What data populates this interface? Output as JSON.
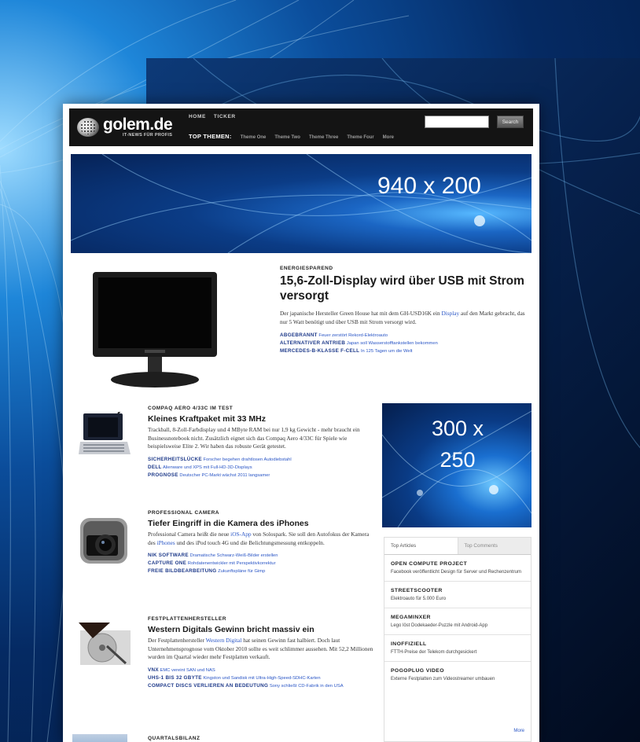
{
  "site": {
    "logo": "golem.de",
    "tagline": "IT-NEWS FÜR PROFIS",
    "nav_top": [
      "HOME",
      "TICKER"
    ],
    "themes_label": "TOP THEMEN:",
    "themes": [
      "Theme One",
      "Theme Two",
      "Theme Three",
      "Theme Four",
      "More"
    ],
    "search_placeholder": "",
    "search_button": "Search"
  },
  "banner": {
    "label": "940 x 200"
  },
  "ad": {
    "label": "300 x 250"
  },
  "feature": {
    "kicker": "ENERGIESPAREND",
    "title": "15,6-Zoll-Display wird über USB mit Strom versorgt",
    "desc_pre": "Der japanische Hersteller Green House hat mit dem GH-USD16K ein ",
    "desc_link": "Display",
    "desc_post": " auf den Markt gebracht, das nur 5 Watt benötigt und über USB mit Strom versorgt wird.",
    "related": [
      {
        "key": "ABGEBRANNT",
        "text": "Feuer zerstört Rekord-Elektroauto"
      },
      {
        "key": "ALTERNATIVER ANTRIEB",
        "text": "Japan soll Wasserstofftankstellen bekommen"
      },
      {
        "key": "MERCEDES-B-KLASSE F-CELL",
        "text": "In 125 Tagen um die Welt"
      }
    ]
  },
  "articles": [
    {
      "kicker": "COMPAQ AERO 4/33C IM TEST",
      "title": "Kleines Kraftpaket mit 33 MHz",
      "desc": "Trackball, 8-Zoll-Farbdisplay und 4 MByte RAM bei nur 1,9 kg Gewicht - mehr braucht ein Businessnotebook nicht. Zusätzlich eignet sich das Compaq Aero 4/33C für Spiele wie beispielsweise Elite 2. Wir haben das robuste Gerät getestet.",
      "related": [
        {
          "key": "SICHERHEITSLÜCKE",
          "text": "Forscher begehen drahtlosen Autodiebstahl"
        },
        {
          "key": "DELL",
          "text": "Alienware und XPS mit Full-HD-3D-Displays"
        },
        {
          "key": "PROGNOSE",
          "text": "Deutscher PC-Markt wächst 2011 langsamer"
        }
      ]
    },
    {
      "kicker": "PROFESSIONAL CAMERA",
      "title": "Tiefer Eingriff in die Kamera des iPhones",
      "desc_parts": [
        "Professional Camera heißt die neue ",
        "iOS-App",
        " von Solospark. Sie soll den Autofokus der Kamera des ",
        "iPhones",
        " und des iPod touch 4G und die Belichtungsmessung entkoppeln."
      ],
      "related": [
        {
          "key": "NIK SOFTWARE",
          "text": "Dramatische Schwarz-Weiß-Bilder erstellen"
        },
        {
          "key": "CAPTURE ONE",
          "text": "Rohdatenentwickler mit Perspektivkorrektur"
        },
        {
          "key": "FREIE BILDBEARBEITUNG",
          "text": "Zukunftspläne für Gimp"
        }
      ]
    },
    {
      "kicker": "FESTPLATTENHERSTELLER",
      "title": "Western Digitals Gewinn bricht massiv ein",
      "desc_parts": [
        "Der Festplattenhersteller ",
        "Western Digital",
        " hat seinen Gewinn fast halbiert. Doch laut Unternehmensprognose vom Oktober 2010 sollte es weit schlimmer aussehen. Mit 52,2 Millionen wurden im Quartal wieder mehr Festplatten verkauft."
      ],
      "related": [
        {
          "key": "VNX",
          "text": "EMC vereint SAN und NAS"
        },
        {
          "key": "UHS-1 BIS 32 GBYTE",
          "text": "Kingston und Sandisk mit Ultra-High-Speed-SDHC-Karten"
        },
        {
          "key": "COMPACT DISCS VERLIEREN AN BEDEUTUNG",
          "text": "Sony schließt CD-Fabrik in den USA"
        }
      ]
    }
  ],
  "last_kicker": "QUARTALSBILANZ",
  "sidebar": {
    "tabs": [
      "Top Articles",
      "Top Comments"
    ],
    "items": [
      {
        "title": "OPEN COMPUTE PROJECT",
        "desc": "Facebook veröffentlicht Design für Server und Rechenzentrum"
      },
      {
        "title": "STREETSCOOTER",
        "desc": "Elektroauto für 5.000 Euro"
      },
      {
        "title": "MEGAMINXER",
        "desc": "Lego löst Dodekaeder-Puzzle mit Android-App"
      },
      {
        "title": "INOFFIZIELL",
        "desc": "FTTH-Preise der Telekom durchgesickert"
      },
      {
        "title": "POGOPLUG VIDEO",
        "desc": "Externe Festplatten zum Videostreamer umbauen"
      }
    ],
    "more": "More"
  }
}
